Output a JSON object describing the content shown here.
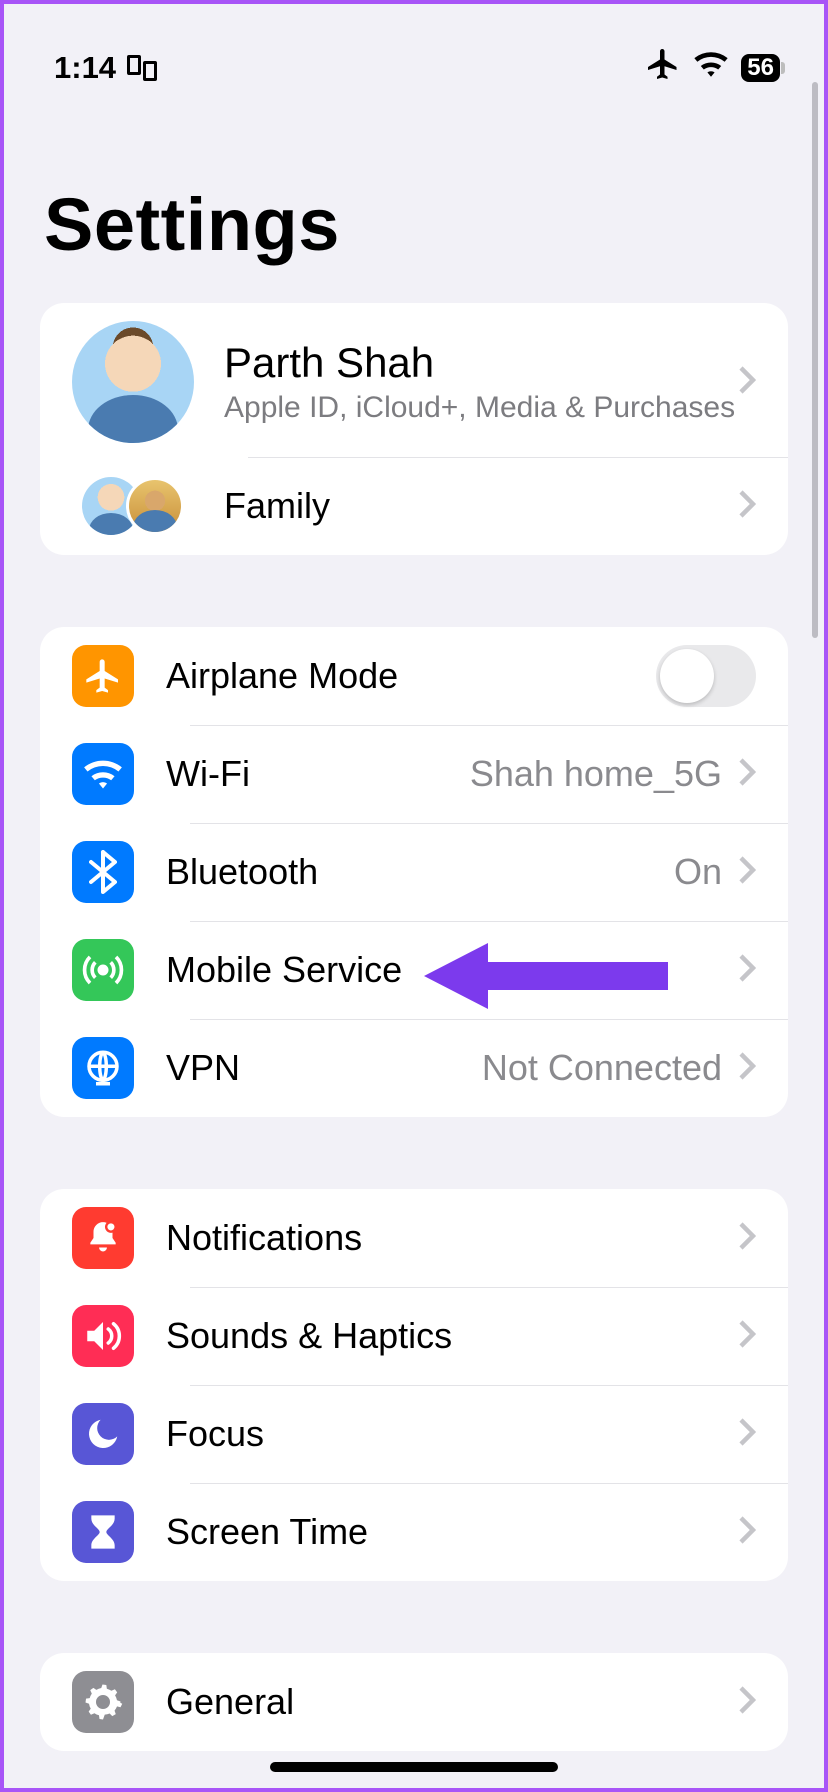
{
  "status": {
    "time": "1:14",
    "battery": "56"
  },
  "title": "Settings",
  "account": {
    "name": "Parth Shah",
    "subtitle": "Apple ID, iCloud+, Media & Purchases",
    "family_label": "Family"
  },
  "network": {
    "airplane": "Airplane Mode",
    "wifi": "Wi-Fi",
    "wifi_value": "Shah home_5G",
    "bluetooth": "Bluetooth",
    "bluetooth_value": "On",
    "mobile": "Mobile Service",
    "vpn": "VPN",
    "vpn_value": "Not Connected"
  },
  "prefs": {
    "notifications": "Notifications",
    "sounds": "Sounds & Haptics",
    "focus": "Focus",
    "screentime": "Screen Time"
  },
  "general": {
    "label": "General"
  }
}
